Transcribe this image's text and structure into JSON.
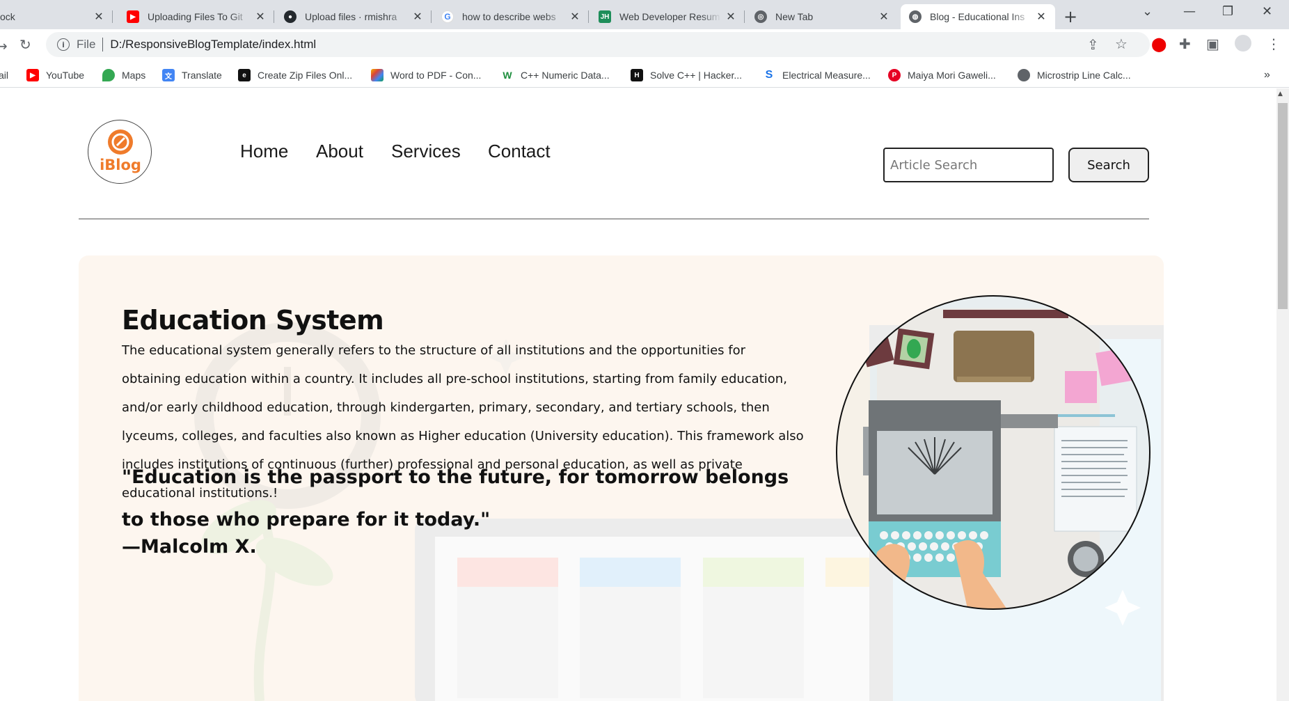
{
  "browser": {
    "tabs": [
      {
        "title": "ock",
        "favicon": "page-icon"
      },
      {
        "title": "Uploading Files To Git",
        "favicon": "youtube-icon"
      },
      {
        "title": "Upload files · rmishra",
        "favicon": "github-icon"
      },
      {
        "title": "how to describe webs",
        "favicon": "google-icon"
      },
      {
        "title": "Web Developer Resum",
        "favicon": "jh-icon"
      },
      {
        "title": "New Tab",
        "favicon": "chrome-icon"
      },
      {
        "title": "Blog - Educational Ins",
        "favicon": "globe-icon"
      }
    ],
    "address": {
      "scheme_label": "File",
      "url": "D:/ResponsiveBlogTemplate/index.html"
    },
    "bookmarks": [
      {
        "label": "ail"
      },
      {
        "label": "YouTube"
      },
      {
        "label": "Maps"
      },
      {
        "label": "Translate"
      },
      {
        "label": "Create Zip Files Onl..."
      },
      {
        "label": "Word to PDF - Con..."
      },
      {
        "label": "C++ Numeric Data..."
      },
      {
        "label": "Solve C++ | Hacker..."
      },
      {
        "label": "Electrical Measure..."
      },
      {
        "label": "Maiya Mori Gaweli..."
      },
      {
        "label": "Microstrip Line Calc..."
      }
    ]
  },
  "site": {
    "logo_text": "iBlog",
    "nav": [
      "Home",
      "About",
      "Services",
      "Contact"
    ],
    "search": {
      "placeholder": "Article Search",
      "button": "Search"
    },
    "hero": {
      "title": "Education System",
      "paragraph": "The educational system generally refers to the structure of all institutions and the opportunities for obtaining education within a country. It includes all pre-school institutions, starting from family education, and/or early childhood education, through kindergarten, primary, secondary, and tertiary schools, then lyceums, colleges, and faculties also known as Higher education (University education). This framework also includes institutions of continuous (further) professional and personal education, as well as private educational institutions.!",
      "quote": "\"Education is the passport to the future, for tomorrow belongs to those who prepare for it today.\"",
      "author": "—Malcolm X."
    }
  },
  "colors": {
    "brand": "#ef7b2b",
    "hero_bg": "#fdf6ef"
  }
}
